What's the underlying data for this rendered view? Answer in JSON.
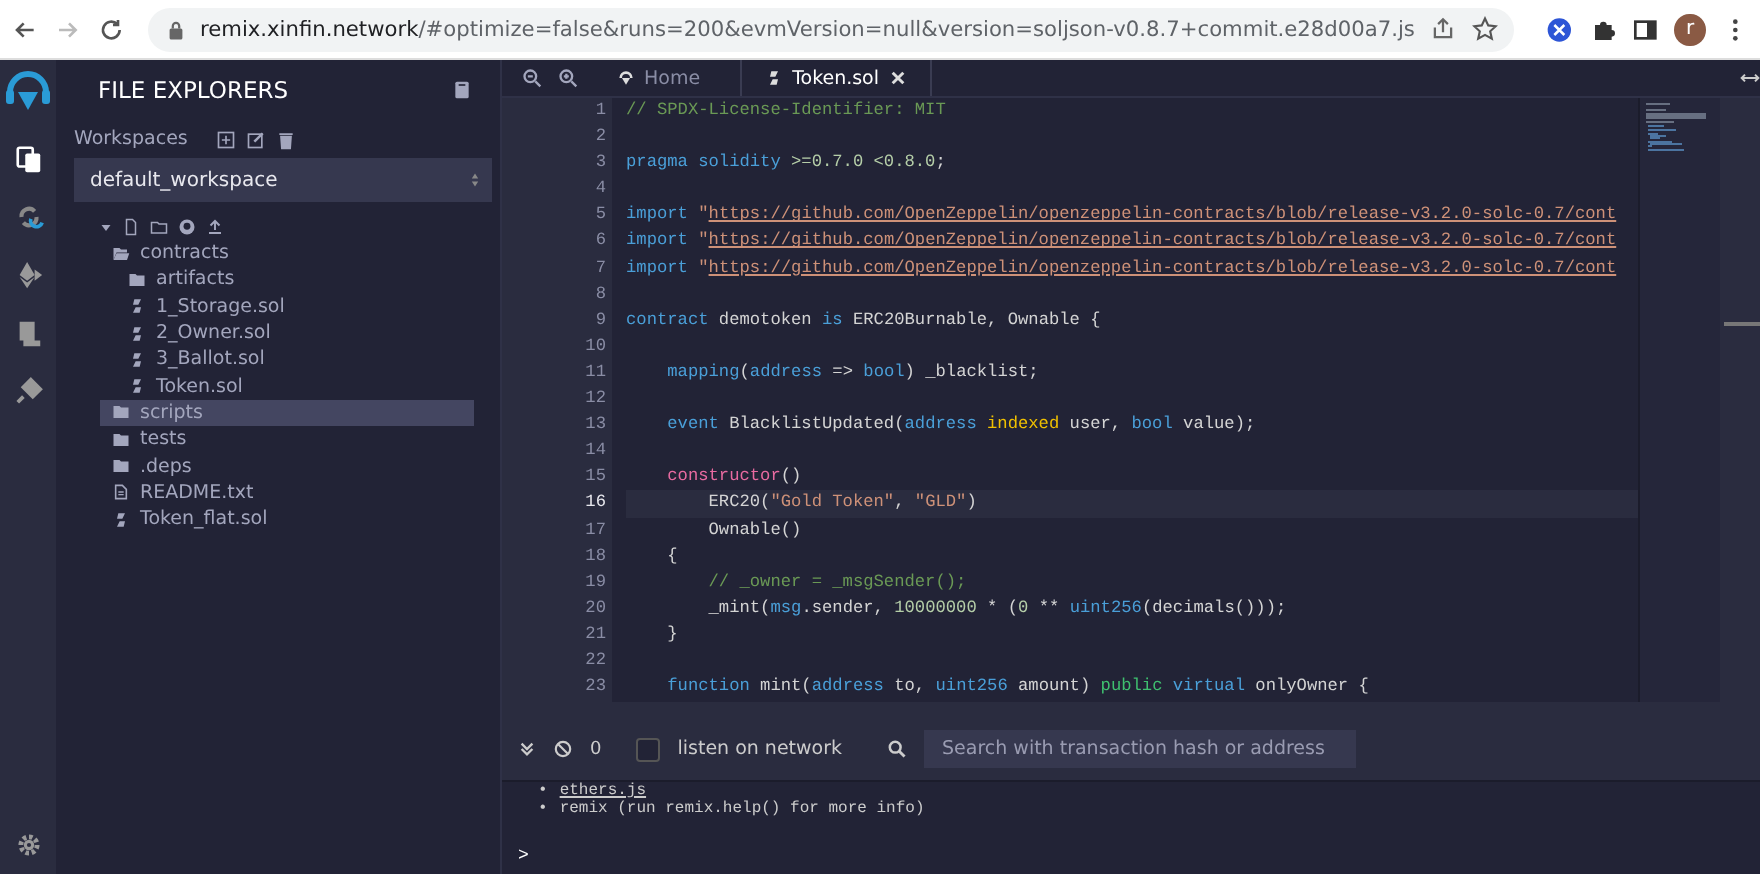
{
  "browser": {
    "back_disabled": false,
    "forward_disabled": true,
    "url_host": "remix.xinfin.network",
    "url_rest": "/#optimize=false&runs=200&evmVersion=null&version=soljson-v0.8.7+commit.e28d00a7.js",
    "avatar": "r"
  },
  "side_panel": {
    "title": "FILE EXPLORERS",
    "workspaces_label": "Workspaces",
    "workspace": "default_workspace",
    "tree": [
      {
        "name": "contracts",
        "kind": "folder",
        "expanded": true,
        "selected": false,
        "children": [
          {
            "name": "artifacts",
            "kind": "folder",
            "expanded": false,
            "selected": false
          },
          {
            "name": "1_Storage.sol",
            "kind": "sol",
            "selected": false
          },
          {
            "name": "2_Owner.sol",
            "kind": "sol",
            "selected": false
          },
          {
            "name": "3_Ballot.sol",
            "kind": "sol",
            "selected": false
          },
          {
            "name": "Token.sol",
            "kind": "sol",
            "selected": false
          }
        ]
      },
      {
        "name": "scripts",
        "kind": "folder",
        "expanded": false,
        "selected": true
      },
      {
        "name": "tests",
        "kind": "folder",
        "expanded": false,
        "selected": false
      },
      {
        "name": ".deps",
        "kind": "folder",
        "expanded": false,
        "selected": false
      },
      {
        "name": "README.txt",
        "kind": "text",
        "selected": false
      },
      {
        "name": "Token_flat.sol",
        "kind": "sol",
        "selected": false
      }
    ]
  },
  "tabs": [
    {
      "label": "Home",
      "kind": "home",
      "selected": false
    },
    {
      "label": "Token.sol",
      "kind": "sol",
      "selected": true
    }
  ],
  "code": [
    {
      "n": "1",
      "current": false,
      "tokens": [
        {
          "kind": "comment",
          "text": "// SPDX-License-Identifier: MIT"
        }
      ]
    },
    {
      "n": "2",
      "current": false
    },
    {
      "n": "3",
      "current": false,
      "tokens": [
        {
          "kind": "kw",
          "text": "pragma solidity"
        },
        {
          "kind": "num",
          "text": " >=0.7.0 <0.8.0"
        },
        {
          "kind": "plain",
          "text": ";"
        }
      ]
    },
    {
      "n": "4",
      "current": false
    },
    {
      "n": "5",
      "current": false,
      "tokens": [
        {
          "kind": "kw",
          "text": "import"
        },
        {
          "kind": "str",
          "text": " \""
        },
        {
          "kind": "url",
          "text": "https://github.com/OpenZeppelin/openzeppelin-contracts/blob/release-v3.2.0-solc-0.7/cont"
        }
      ]
    },
    {
      "n": "6",
      "current": false,
      "tokens": [
        {
          "kind": "kw",
          "text": "import"
        },
        {
          "kind": "str",
          "text": " \""
        },
        {
          "kind": "url",
          "text": "https://github.com/OpenZeppelin/openzeppelin-contracts/blob/release-v3.2.0-solc-0.7/cont"
        }
      ]
    },
    {
      "n": "7",
      "current": false,
      "tokens": [
        {
          "kind": "kw",
          "text": "import"
        },
        {
          "kind": "str",
          "text": " \""
        },
        {
          "kind": "url",
          "text": "https://github.com/OpenZeppelin/openzeppelin-contracts/blob/release-v3.2.0-solc-0.7/cont"
        }
      ]
    },
    {
      "n": "8",
      "current": false
    },
    {
      "n": "9",
      "current": false,
      "tokens": [
        {
          "kind": "kw",
          "text": "contract"
        },
        {
          "kind": "plain",
          "text": " demotoken "
        },
        {
          "kind": "kw",
          "text": "is"
        },
        {
          "kind": "plain",
          "text": " ERC20Burnable, Ownable {"
        }
      ]
    },
    {
      "n": "10",
      "current": false
    },
    {
      "n": "11",
      "current": false,
      "tokens": [
        {
          "kind": "kw",
          "text": "    mapping"
        },
        {
          "kind": "plain",
          "text": "("
        },
        {
          "kind": "kw",
          "text": "address"
        },
        {
          "kind": "plain",
          "text": " => "
        },
        {
          "kind": "kw",
          "text": "bool"
        },
        {
          "kind": "plain",
          "text": ") _blacklist;"
        }
      ]
    },
    {
      "n": "12",
      "current": false
    },
    {
      "n": "13",
      "current": false,
      "tokens": [
        {
          "kind": "kw",
          "text": "    event"
        },
        {
          "kind": "plain",
          "text": " BlacklistUpdated("
        },
        {
          "kind": "kw",
          "text": "address"
        },
        {
          "kind": "mod",
          "text": " indexed"
        },
        {
          "kind": "plain",
          "text": " user, "
        },
        {
          "kind": "kw",
          "text": "bool"
        },
        {
          "kind": "plain",
          "text": " value);"
        }
      ]
    },
    {
      "n": "14",
      "current": false
    },
    {
      "n": "15",
      "current": false,
      "tokens": [
        {
          "kind": "ctor",
          "text": "    constructor"
        },
        {
          "kind": "plain",
          "text": "()"
        }
      ]
    },
    {
      "n": "16",
      "current": true,
      "tokens": [
        {
          "kind": "plain",
          "text": "        ERC20("
        },
        {
          "kind": "str",
          "text": "\"Gold Token\""
        },
        {
          "kind": "plain",
          "text": ", "
        },
        {
          "kind": "str",
          "text": "\"GLD\""
        },
        {
          "kind": "plain",
          "text": ")"
        }
      ]
    },
    {
      "n": "17",
      "current": false,
      "tokens": [
        {
          "kind": "plain",
          "text": "        Ownable()"
        }
      ]
    },
    {
      "n": "18",
      "current": false,
      "tokens": [
        {
          "kind": "plain",
          "text": "    {"
        }
      ]
    },
    {
      "n": "19",
      "current": false,
      "tokens": [
        {
          "kind": "comment",
          "text": "        // _owner = _msgSender();"
        }
      ]
    },
    {
      "n": "20",
      "current": false,
      "tokens": [
        {
          "kind": "plain",
          "text": "        _mint("
        },
        {
          "kind": "kw",
          "text": "msg"
        },
        {
          "kind": "plain",
          "text": ".sender, "
        },
        {
          "kind": "num",
          "text": "10000000"
        },
        {
          "kind": "plain",
          "text": " * ("
        },
        {
          "kind": "num",
          "text": "0"
        },
        {
          "kind": "plain",
          "text": " ** "
        },
        {
          "kind": "kw",
          "text": "uint256"
        },
        {
          "kind": "plain",
          "text": "(decimals()));"
        }
      ]
    },
    {
      "n": "21",
      "current": false,
      "tokens": [
        {
          "kind": "plain",
          "text": "    }"
        }
      ]
    },
    {
      "n": "22",
      "current": false
    },
    {
      "n": "23",
      "current": false,
      "tokens": [
        {
          "kind": "kw",
          "text": "    function"
        },
        {
          "kind": "plain",
          "text": " mint("
        },
        {
          "kind": "kw",
          "text": "address"
        },
        {
          "kind": "plain",
          "text": " to, "
        },
        {
          "kind": "kw",
          "text": "uint256"
        },
        {
          "kind": "plain",
          "text": " amount) "
        },
        {
          "kind": "vis",
          "text": "public"
        },
        {
          "kind": "kw",
          "text": " virtual"
        },
        {
          "kind": "plain",
          "text": " onlyOwner {"
        }
      ]
    }
  ],
  "terminal": {
    "pending_count": "0",
    "listen_on_network": false,
    "listen_label": "listen on network",
    "search": {
      "placeholder": "Search with transaction hash or address"
    },
    "output": [
      {
        "kind": "link",
        "bullet": "•",
        "text": "ethers.js"
      },
      {
        "kind": "plain",
        "bullet": "•",
        "text": "remix (run remix.help() for more info)"
      }
    ],
    "prompt": ">"
  }
}
